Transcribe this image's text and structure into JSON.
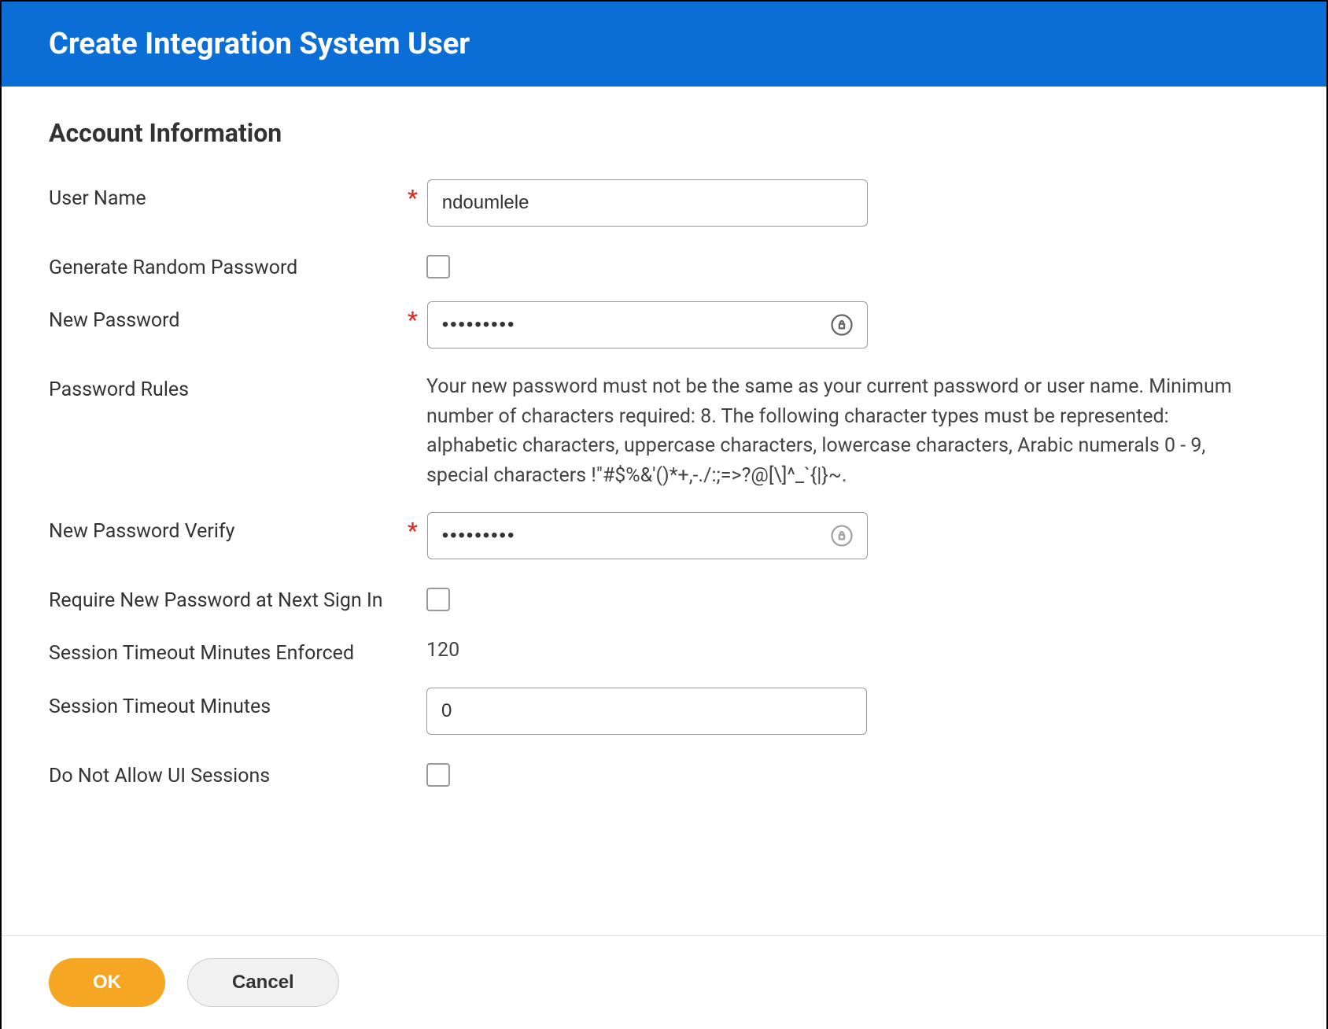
{
  "header": {
    "title": "Create Integration System User"
  },
  "section": {
    "title": "Account Information"
  },
  "fields": {
    "username": {
      "label": "User Name",
      "value": "ndoumlele"
    },
    "random_password": {
      "label": "Generate Random Password"
    },
    "new_password": {
      "label": "New Password",
      "value": "•••••••••"
    },
    "password_rules": {
      "label": "Password Rules",
      "text": "Your new password must not be the same as your current password or user name. Minimum number of characters required: 8. The following character types must be represented: alphabetic characters, uppercase characters, lowercase characters, Arabic numerals 0 - 9, special characters !\"#$%&'()*+,-./:;=>?@[\\]^_`{|}~."
    },
    "new_password_verify": {
      "label": "New Password Verify",
      "value": "•••••••••"
    },
    "require_new_password": {
      "label": "Require New Password at Next Sign In"
    },
    "session_timeout_enforced": {
      "label": "Session Timeout Minutes Enforced",
      "value": "120"
    },
    "session_timeout": {
      "label": "Session Timeout Minutes",
      "value": "0"
    },
    "no_ui_sessions": {
      "label": "Do Not Allow UI Sessions"
    }
  },
  "buttons": {
    "ok": "OK",
    "cancel": "Cancel"
  }
}
